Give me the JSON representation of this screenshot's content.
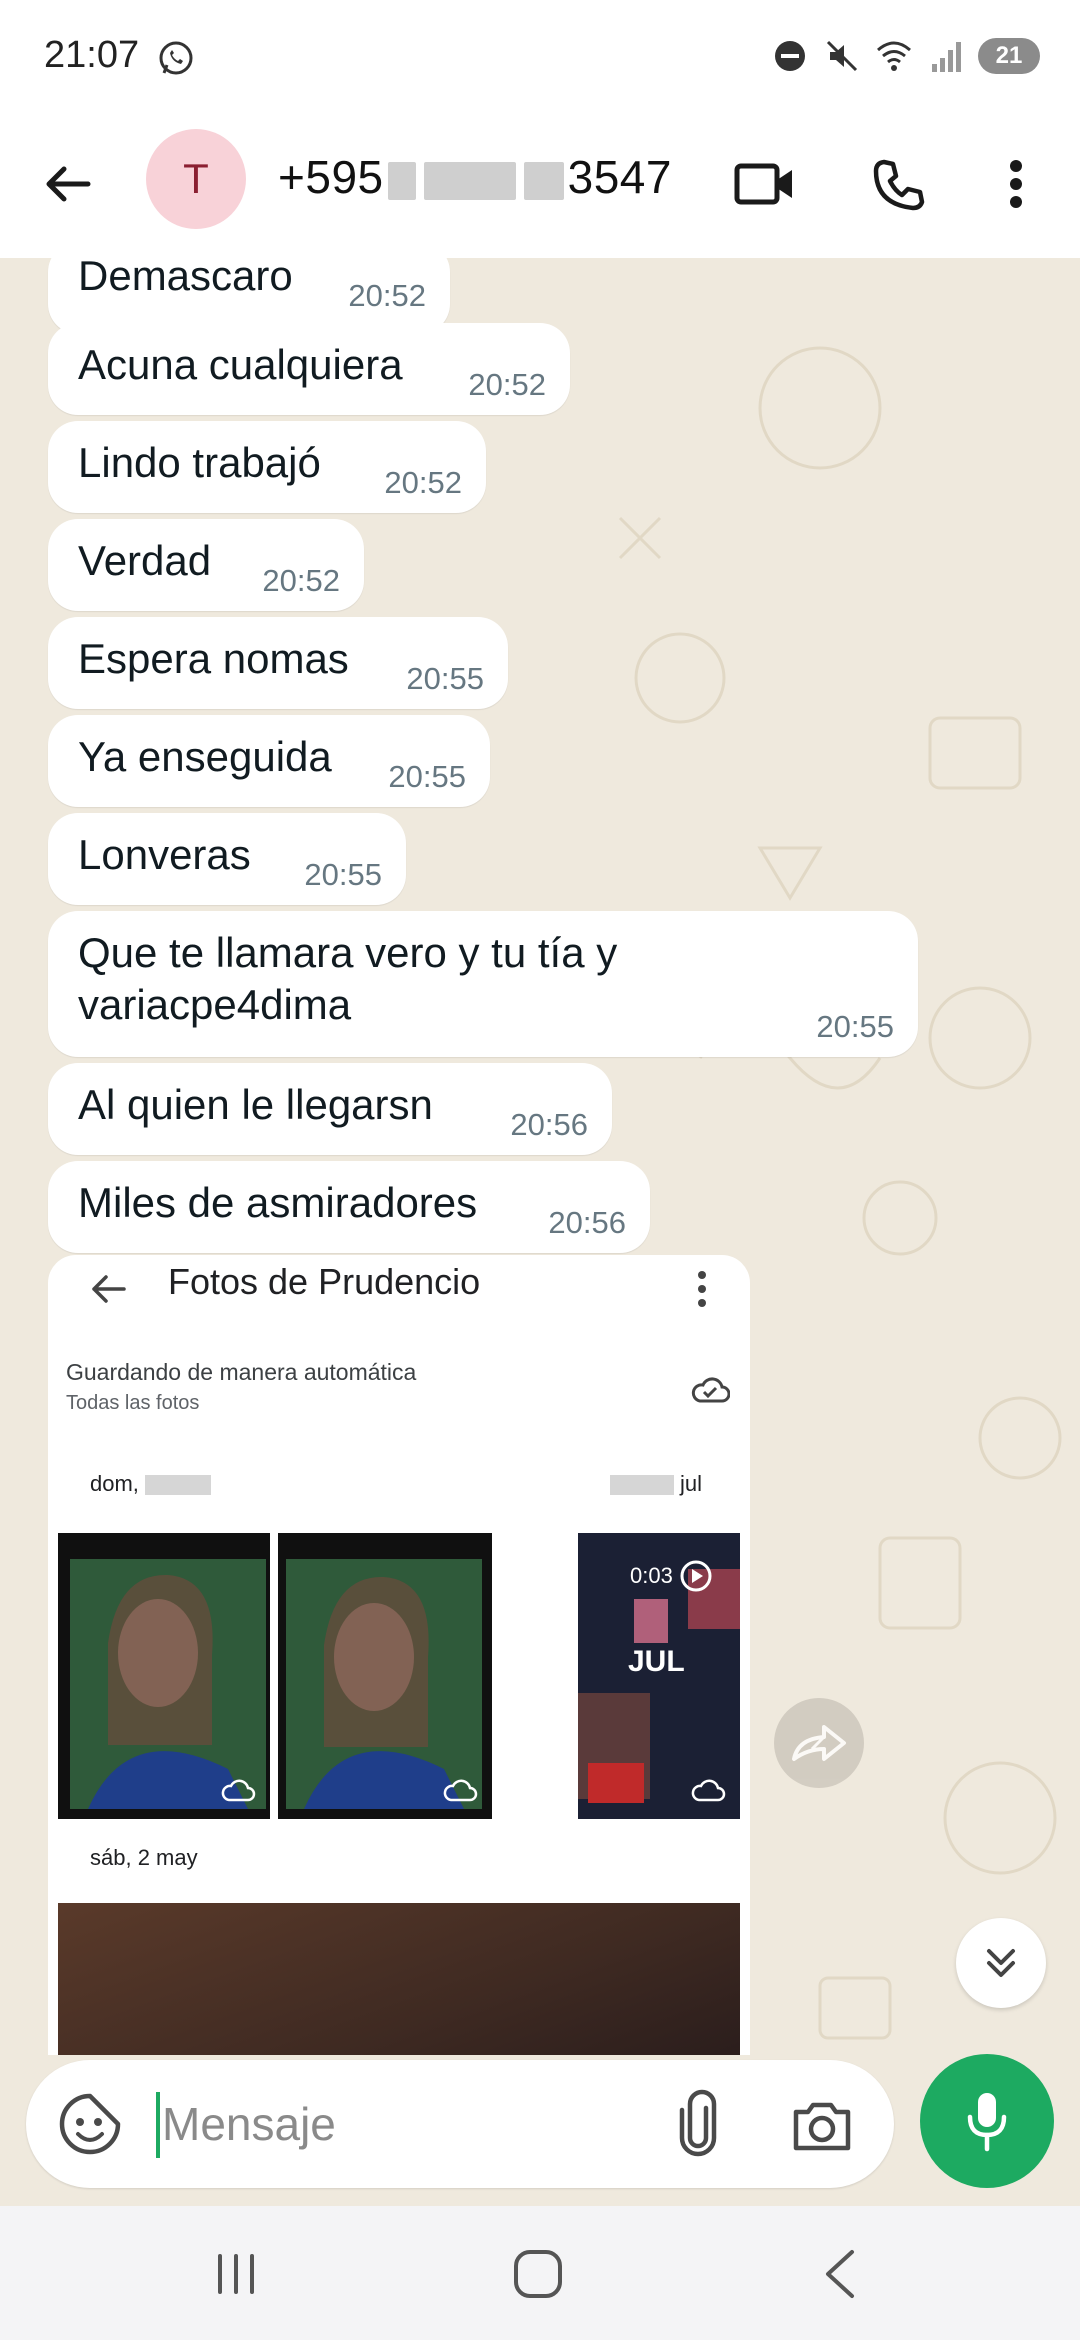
{
  "status_bar": {
    "time": "21:07",
    "battery_level": "21",
    "icons": [
      "whatsapp-icon",
      "do-not-disturb-icon",
      "mute-icon",
      "wifi-icon",
      "signal-icon",
      "battery-icon"
    ]
  },
  "header": {
    "avatar_letter": "T",
    "contact_prefix": "+595",
    "contact_suffix": "3547",
    "icons": [
      "back-arrow-icon",
      "video-call-icon",
      "phone-icon",
      "more-vert-icon"
    ]
  },
  "messages": [
    {
      "text": "Demascaro",
      "time": "20:52"
    },
    {
      "text": "Acuna cualquiera",
      "time": "20:52"
    },
    {
      "text": "Lindo trabajó",
      "time": "20:52"
    },
    {
      "text": "Verdad",
      "time": "20:52"
    },
    {
      "text": "Espera nomas",
      "time": "20:55"
    },
    {
      "text": "Ya enseguida",
      "time": "20:55"
    },
    {
      "text": "Lonveras",
      "time": "20:55"
    },
    {
      "text": "Que te llamara vero y tu tía y",
      "text2": "variacpe4dima",
      "time": "20:55"
    },
    {
      "text": "Al quien le  llegarsn",
      "time": "20:56"
    },
    {
      "text": "Miles de asmiradores",
      "time": "20:56"
    }
  ],
  "image_message": {
    "title": "Fotos de Prudencio",
    "saving_text": "Guardando de manera automática",
    "subtitle": "Todas las fotos",
    "date1_prefix": "dom,",
    "date2_suffix": "jul",
    "video_duration": "0:03",
    "video_label": "JUL",
    "date3": "sáb, 2 may"
  },
  "composer": {
    "placeholder": "Mensaje"
  },
  "colors": {
    "accent_green": "#1daa61",
    "chat_background": "#efe9dd",
    "avatar_bg": "#f8d2d8",
    "avatar_text": "#8b1f31"
  }
}
